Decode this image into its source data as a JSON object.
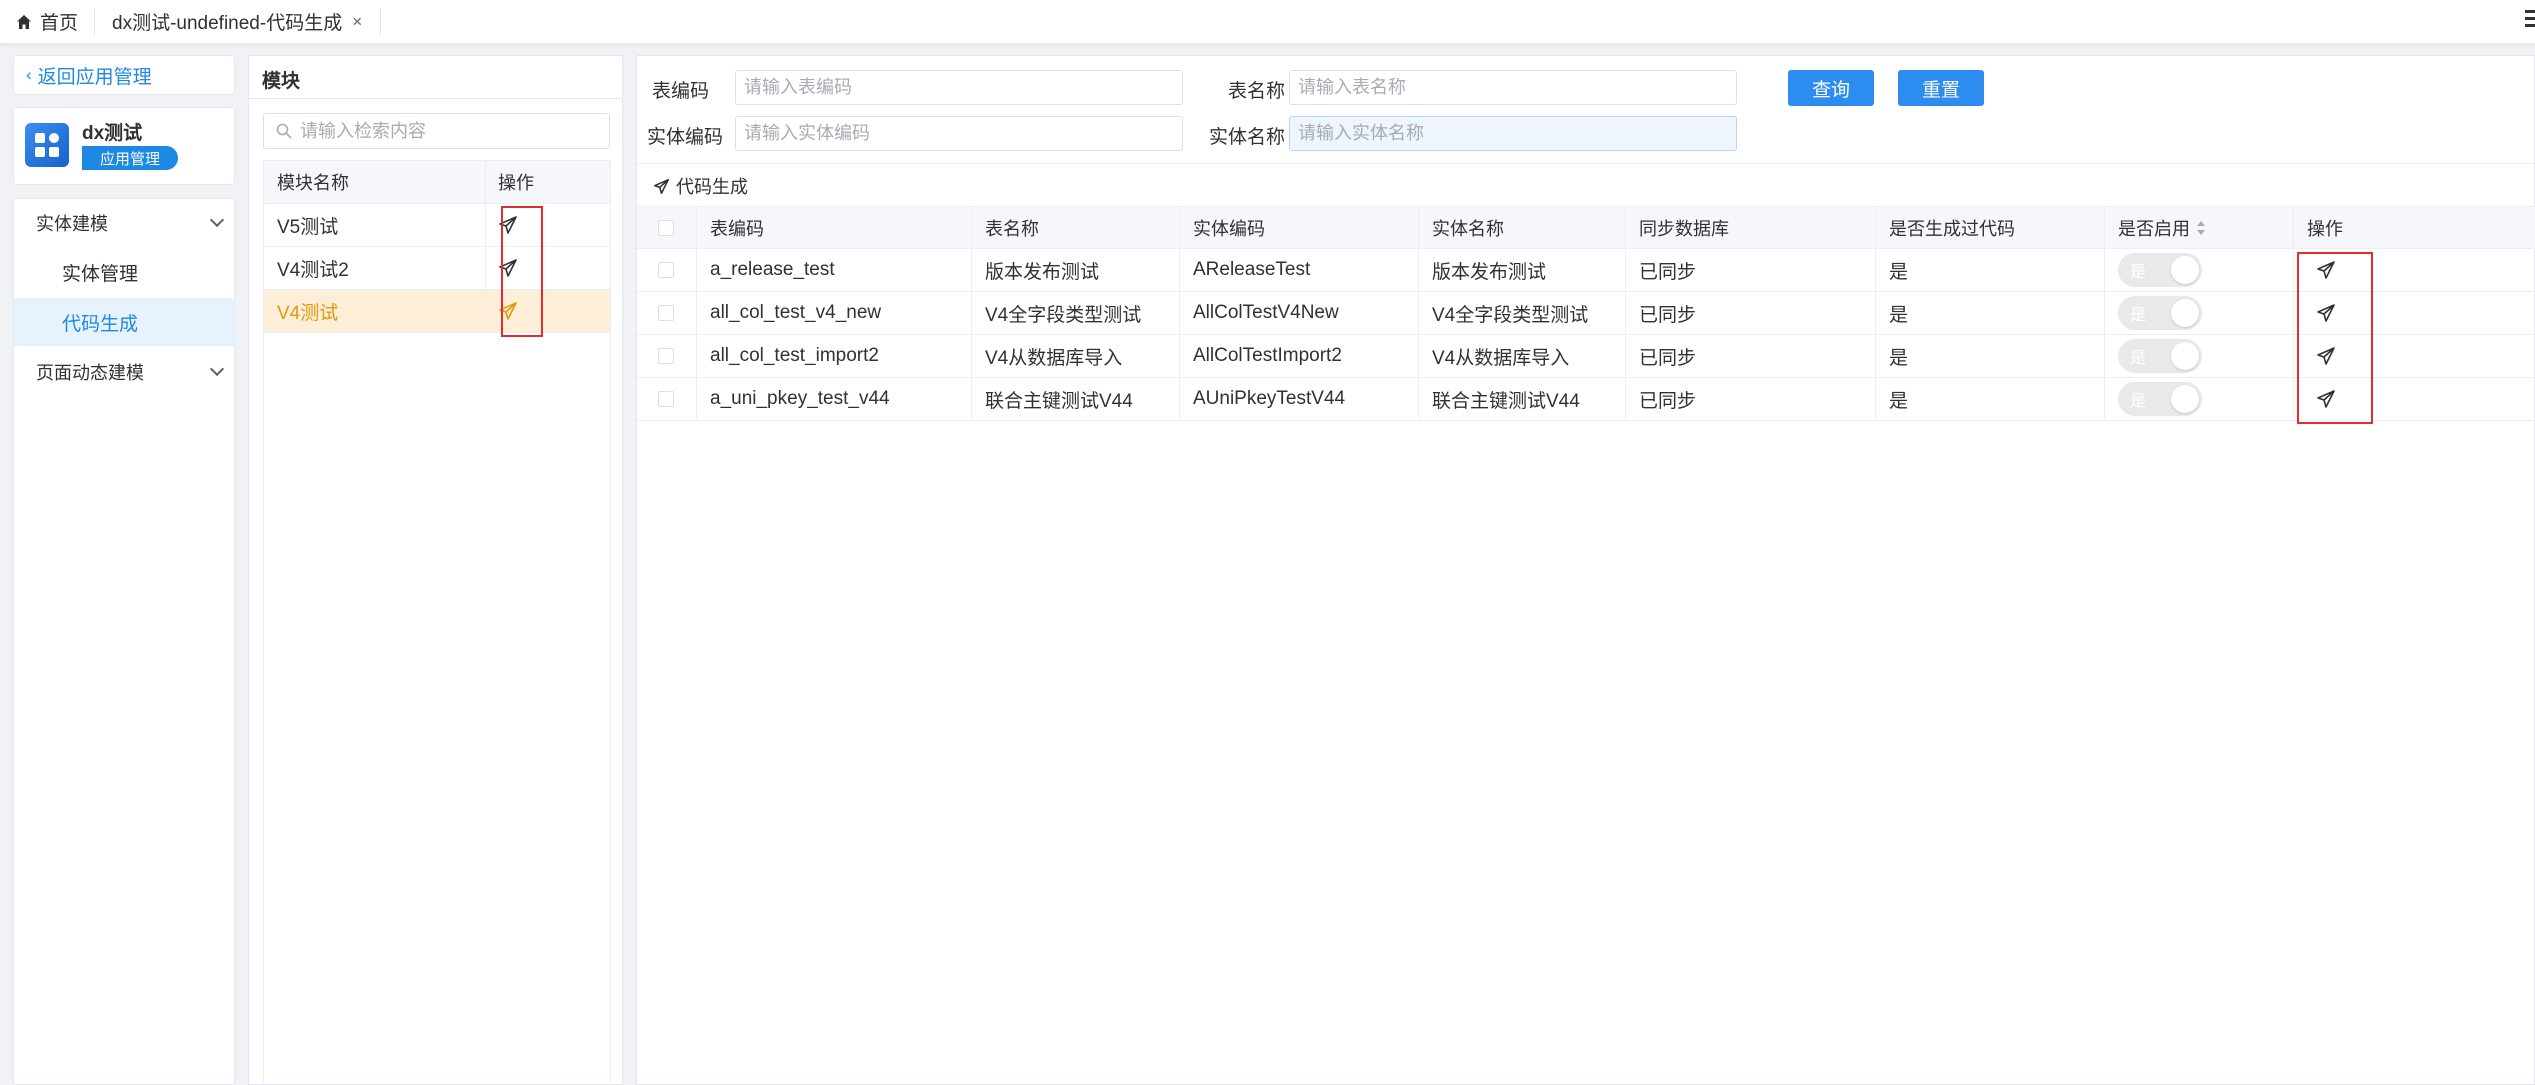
{
  "tabs": [
    {
      "label": "首页",
      "icon": "home-icon"
    },
    {
      "label": "dx测试-undefined-代码生成",
      "close": "×"
    }
  ],
  "sidebar": {
    "back_label": "返回应用管理",
    "app": {
      "name": "dx测试",
      "badge": "应用管理"
    },
    "groups": [
      {
        "label": "实体建模",
        "items": [
          "实体管理",
          "代码生成"
        ],
        "active_item": "代码生成"
      },
      {
        "label": "页面动态建模"
      }
    ]
  },
  "module_panel": {
    "title": "模块",
    "search_placeholder": "请输入检索内容",
    "columns": [
      "模块名称",
      "操作"
    ],
    "rows": [
      {
        "name": "V5测试",
        "selected": false
      },
      {
        "name": "V4测试2",
        "selected": false
      },
      {
        "name": "V4测试",
        "selected": true
      }
    ]
  },
  "search_form": {
    "table_code_label": "表编码",
    "table_code_placeholder": "请输入表编码",
    "table_name_label": "表名称",
    "table_name_placeholder": "请输入表名称",
    "entity_code_label": "实体编码",
    "entity_code_placeholder": "请输入实体编码",
    "entity_name_label": "实体名称",
    "entity_name_placeholder": "请输入实体名称",
    "query_button": "查询",
    "reset_button": "重置"
  },
  "toolbar": {
    "generate_label": "代码生成"
  },
  "table": {
    "columns": [
      "表编码",
      "表名称",
      "实体编码",
      "实体名称",
      "同步数据库",
      "是否生成过代码",
      "是否启用",
      "操作"
    ],
    "rows": [
      {
        "table_code": "a_release_test",
        "table_name": "版本发布测试",
        "entity_code": "AReleaseTest",
        "entity_name": "版本发布测试",
        "sync": "已同步",
        "generated": "是",
        "enabled_label": "是",
        "enabled": false
      },
      {
        "table_code": "all_col_test_v4_new",
        "table_name": "V4全字段类型测试",
        "entity_code": "AllColTestV4New",
        "entity_name": "V4全字段类型测试",
        "sync": "已同步",
        "generated": "是",
        "enabled_label": "是",
        "enabled": false
      },
      {
        "table_code": "all_col_test_import2",
        "table_name": "V4从数据库导入",
        "entity_code": "AllColTestImport2",
        "entity_name": "V4从数据库导入",
        "sync": "已同步",
        "generated": "是",
        "enabled_label": "是",
        "enabled": false
      },
      {
        "table_code": "a_uni_pkey_test_v44",
        "table_name": "联合主键测试V44",
        "entity_code": "AUniPkeyTestV44",
        "entity_name": "联合主键测试V44",
        "sync": "已同步",
        "generated": "是",
        "enabled_label": "是",
        "enabled": false
      }
    ]
  },
  "colors": {
    "accent": "#2d8cf0",
    "selected_row": "#fdefd7",
    "selected_text": "#e6960f",
    "highlight_box": "#e52b2b"
  }
}
